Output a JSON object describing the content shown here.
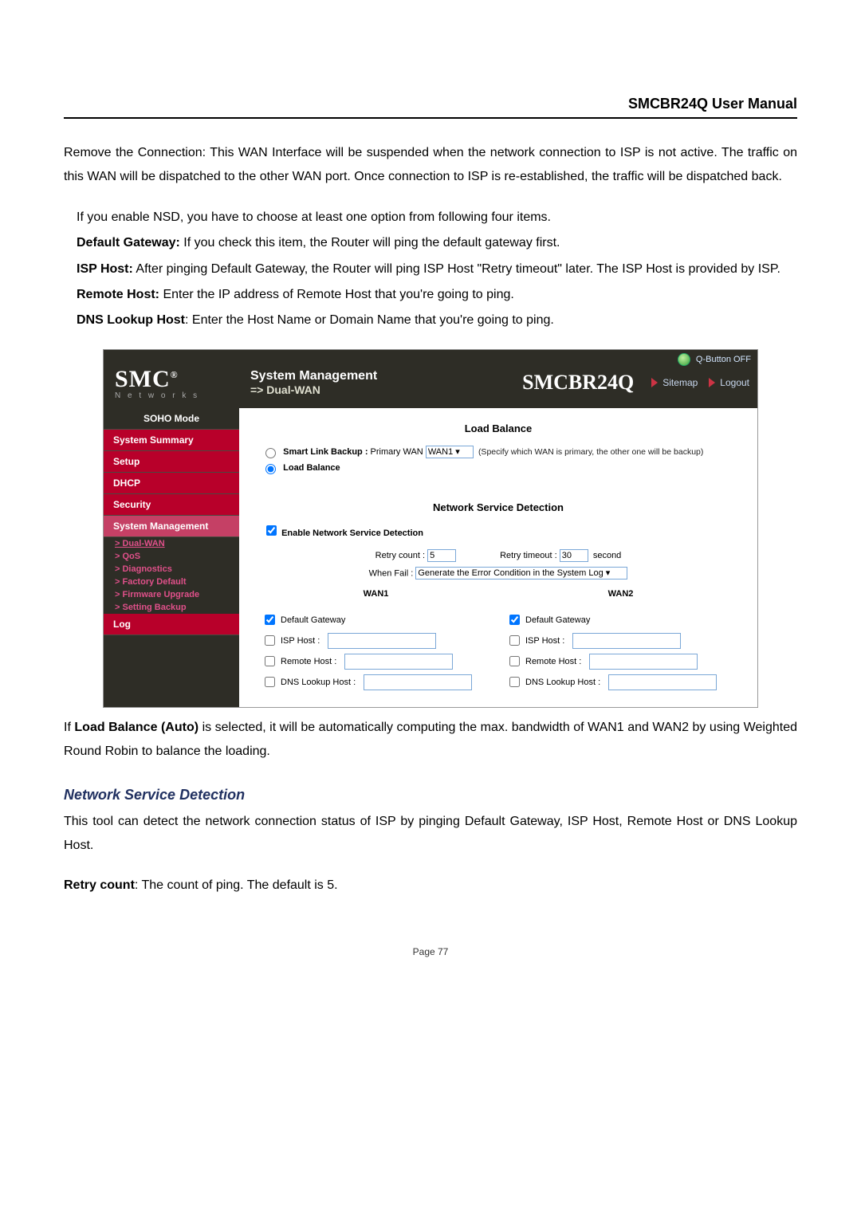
{
  "doc": {
    "header": "SMCBR24Q User Manual",
    "para1": "Remove the Connection: This WAN Interface will be suspended when the network connection to ISP is not active. The traffic on this WAN will be dispatched to the other WAN port. Once connection to ISP is re-established, the traffic will be dispatched back.",
    "list_intro": "If you enable NSD, you have to choose at least one option from following four items.",
    "bullets": {
      "default_gateway_b": "Default Gateway:",
      "default_gateway": " If you check this item, the Router will ping the default gateway first.",
      "isp_host_b": "ISP Host:",
      "isp_host": " After pinging Default Gateway, the Router will ping ISP Host \"Retry timeout\" later. The ISP Host is provided by ISP.",
      "remote_host_b": "Remote Host:",
      "remote_host": " Enter the IP address of Remote Host that you're going to ping.",
      "dns_b": "DNS Lookup Host",
      "dns": ": Enter the Host Name or Domain Name that you're going to ping."
    },
    "para_after": "If Load Balance (Auto) is selected, it will be automatically computing the max. bandwidth of WAN1 and WAN2 by using Weighted Round Robin to balance the loading.",
    "bold_span": "Load Balance (Auto)",
    "nsd_heading": "Network Service Detection",
    "nsd_para": "This tool can detect the network connection status of ISP by pinging Default Gateway, ISP Host, Remote Host or DNS Lookup Host.",
    "retry_count_b": "Retry count",
    "retry_count": ": The count of ping. The default is 5.",
    "page_number": "Page 77"
  },
  "ui": {
    "qbutton": "Q-Button OFF",
    "logo_main": "SMC",
    "logo_reg": "®",
    "logo_sub": "N e t w o r k s",
    "sys_mgmt": "System Management",
    "breadcrumb": "=> Dual-WAN",
    "model": "SMCBR24Q",
    "sitemap": "Sitemap",
    "logout": "Logout",
    "sidebar": {
      "soho": "SOHO Mode",
      "summary": "System Summary",
      "setup": "Setup",
      "dhcp": "DHCP",
      "security": "Security",
      "sysmgmt": "System Management",
      "sub": {
        "dualwan": "> Dual-WAN",
        "qos": "> QoS",
        "diag": "> Diagnostics",
        "factory": "> Factory Default",
        "fw": "> Firmware Upgrade",
        "setting": "> Setting Backup"
      },
      "log": "Log"
    },
    "panel": {
      "lb_title": "Load Balance",
      "smart_b": "Smart Link Backup :",
      "smart_lbl": "Primary WAN",
      "smart_sel": "WAN1 ▾",
      "smart_hint": "(Specify which WAN is primary, the other one will be backup)",
      "load_bal": "Load Balance",
      "nsd_title": "Network Service Detection",
      "enable_nsd": "Enable Network Service Detection",
      "retry_count": "Retry count :",
      "retry_count_val": "5",
      "retry_timeout": "Retry timeout :",
      "retry_timeout_val": "30",
      "second": "second",
      "when_fail": "When Fail :",
      "when_fail_sel": "Generate the Error Condition in the System Log ▾",
      "wan1": "WAN1",
      "wan2": "WAN2",
      "dg": "Default Gateway",
      "isp": "ISP Host :",
      "remote": "Remote Host :",
      "dns": "DNS Lookup Host :"
    }
  }
}
